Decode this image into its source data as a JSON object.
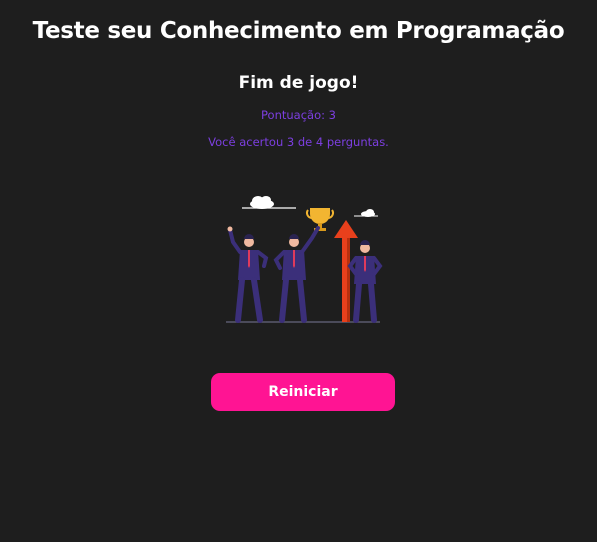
{
  "header": {
    "title": "Teste seu Conhecimento em Programação"
  },
  "result": {
    "heading": "Fim de jogo!",
    "score_text": "Pontuação: 3",
    "summary_text": "Você acertou 3 de 4 perguntas."
  },
  "illustration": {
    "icon": "winners-trophy-illustration",
    "colors": {
      "suit": "#3b2f7a",
      "tie": "#e03a5c",
      "trophy": "#f2b531",
      "arrow": "#e8401c",
      "cloud": "#ffffff"
    }
  },
  "actions": {
    "restart_label": "Reiniciar"
  },
  "theme": {
    "background": "#1e1e1e",
    "accent": "#ff1493",
    "secondary_text": "#7c3fe0"
  }
}
